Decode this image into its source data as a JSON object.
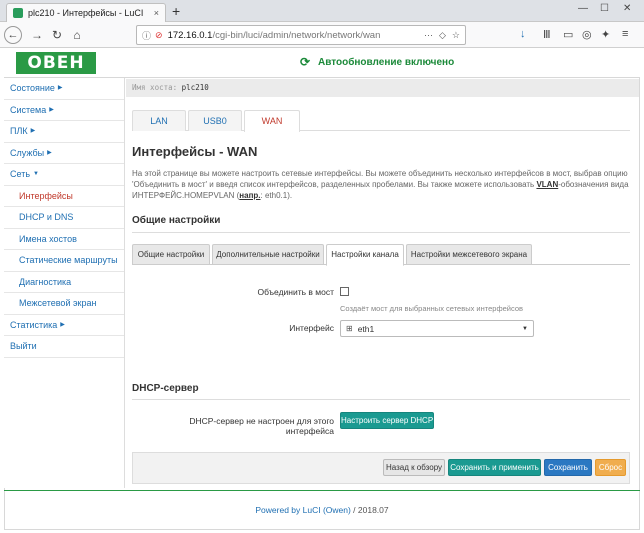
{
  "browser": {
    "tab_title": "plc210 - Интерфейсы - LuCI",
    "tab_close": "×",
    "new_tab": "+",
    "url_host": "172.16.0.1",
    "url_path": "/cgi-bin/luci/admin/network/network/wan"
  },
  "header": {
    "logo_text": "ОВЕН",
    "autorefresh": "Автообновление включено"
  },
  "hostbar": {
    "label": "Имя хоста:",
    "value": "plc210"
  },
  "sidebar": {
    "items": [
      {
        "label": "Состояние",
        "arrow": "▶"
      },
      {
        "label": "Система",
        "arrow": "▶"
      },
      {
        "label": "ПЛК",
        "arrow": "▶"
      },
      {
        "label": "Службы",
        "arrow": "▶"
      },
      {
        "label": "Сеть",
        "arrow": "▼"
      },
      {
        "label": "Интерфейсы"
      },
      {
        "label": "DHCP и DNS"
      },
      {
        "label": "Имена хостов"
      },
      {
        "label": "Статические маршруты"
      },
      {
        "label": "Диагностика"
      },
      {
        "label": "Межсетевой экран"
      },
      {
        "label": "Статистика",
        "arrow": "▶"
      },
      {
        "label": "Выйти"
      }
    ]
  },
  "iface_tabs": [
    "LAN",
    "USB0",
    "WAN"
  ],
  "page": {
    "title": "Интерфейсы - WAN",
    "desc_part1": "На этой странице вы можете настроить сетевые интерфейсы. Вы можете объединить несколько интерфейсов в мост, выбрав опцию 'Объединить в мост' и введя список интерфейсов, разделенных пробелами. Вы также можете использовать ",
    "desc_vlan": "VLAN",
    "desc_part2": "-обозначения вида ИНТЕРФЕЙС.НОМЕРVLAN (",
    "desc_example": "напр.",
    "desc_part3": ": eth0.1)."
  },
  "general": {
    "title": "Общие настройки",
    "tabs": [
      "Общие настройки",
      "Дополнительные настройки",
      "Настройки канала",
      "Настройки межсетевого экрана"
    ],
    "bridge_label": "Объединить в мост",
    "bridge_hint": "Создаёт мост для выбранных сетевых интерфейсов",
    "iface_label": "Интерфейс",
    "iface_value": "eth1"
  },
  "dhcp": {
    "title": "DHCP-сервер",
    "label": "DHCP-сервер не настроен для этого интерфейса",
    "button": "Настроить сервер DHCP"
  },
  "actions": {
    "back": "Назад к обзору",
    "save_apply": "Сохранить и применить",
    "save": "Сохранить",
    "reset": "Сброс"
  },
  "footer": {
    "powered": "Powered by LuCI (Owen)",
    "version": " / 2018.07"
  },
  "colors": {
    "brand_green": "#2a9a45",
    "link_blue": "#1f6fb2",
    "active_red": "#c0392b",
    "teal_button": "#1a9a91"
  }
}
